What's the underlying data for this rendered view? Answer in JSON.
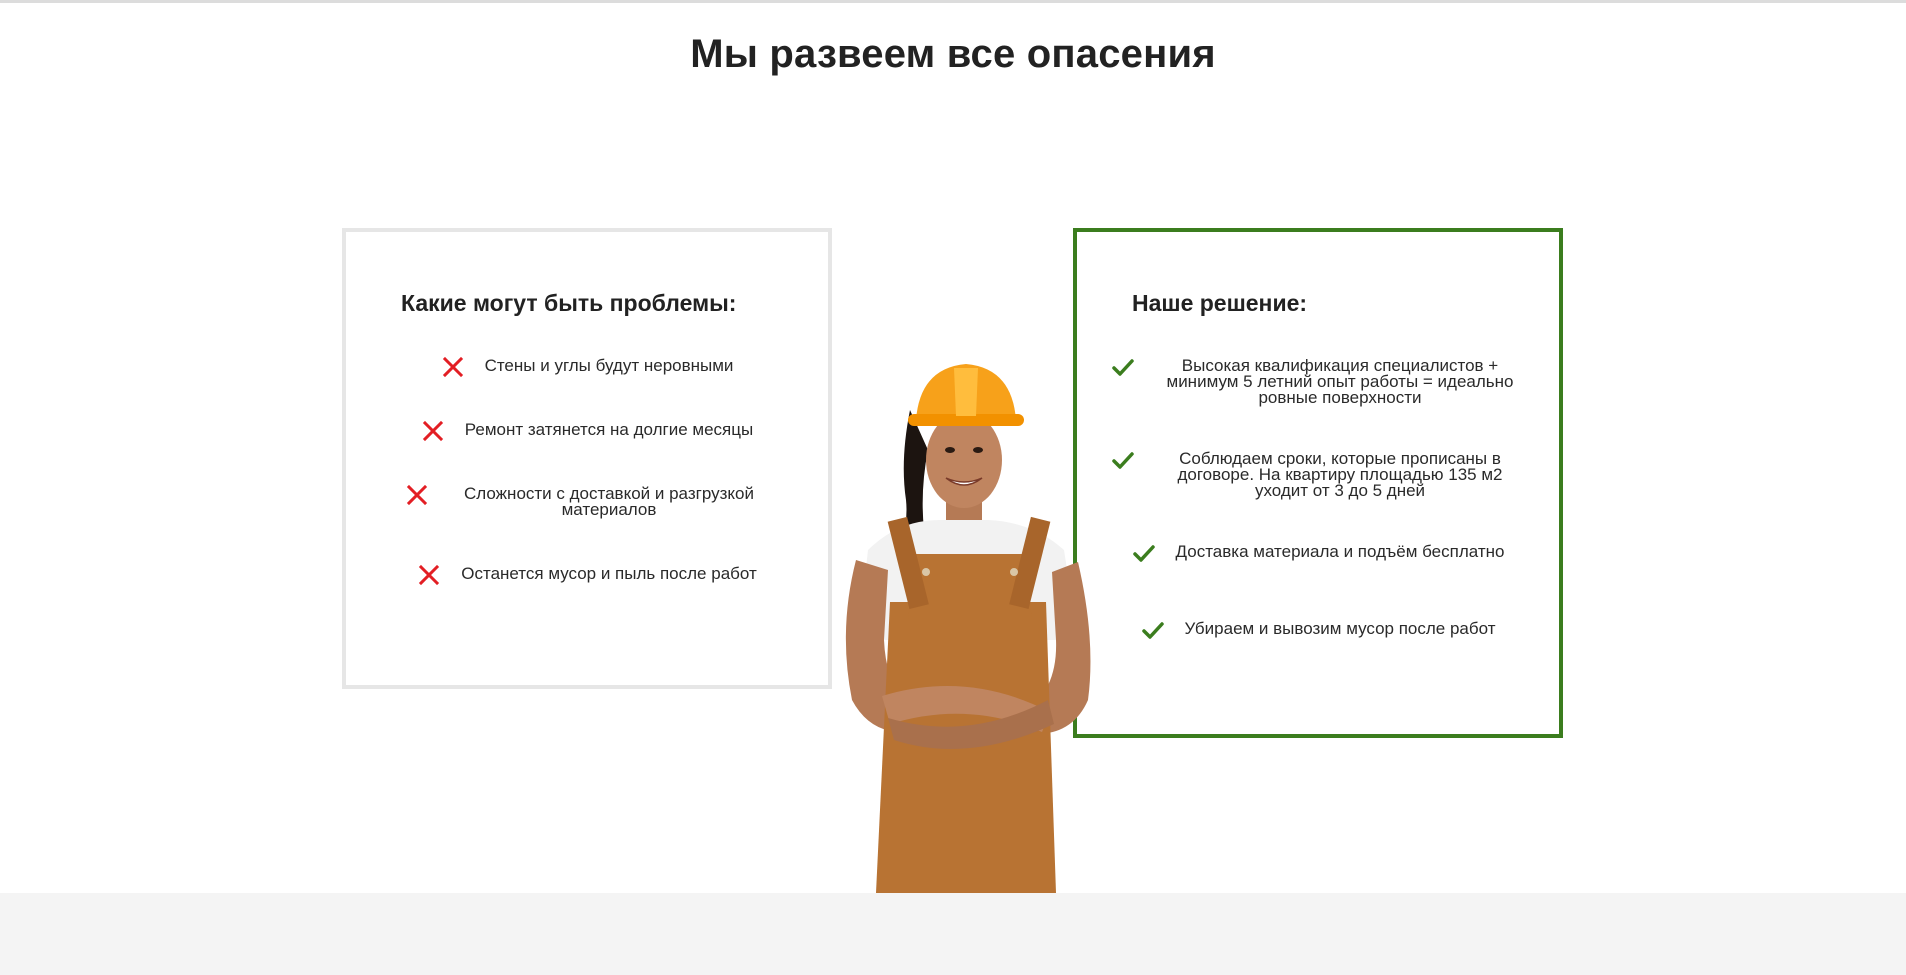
{
  "section": {
    "title": "Мы развеем все опасения"
  },
  "problems": {
    "title": "Какие могут быть проблемы:",
    "icon": "cross-icon",
    "icon_color": "#e31e24",
    "items": [
      "Стены и углы будут неровными",
      "Ремонт затянется на долгие месяцы",
      "Сложности с доставкой и разгрузкой материалов",
      "Останется мусор и пыль после работ"
    ]
  },
  "solutions": {
    "title": "Наше решение:",
    "icon": "checkmark-icon",
    "icon_color": "#3b7d1e",
    "items": [
      "Высокая квалификация специалистов + минимум 5 летний опыт работы = идеально ровные поверхности",
      "Соблюдаем сроки, которые прописаны в договоре. На квартиру площадью 135 м2 уходит от 3 до 5 дней",
      "Доставка материала и подъём бесплатно",
      "Убираем и вывозим мусор после работ"
    ]
  },
  "colors": {
    "accent_green": "#3b7d1e",
    "problem_red": "#e31e24",
    "card_border_grey": "#e6e6e6",
    "footer_band": "#f4f4f4"
  }
}
